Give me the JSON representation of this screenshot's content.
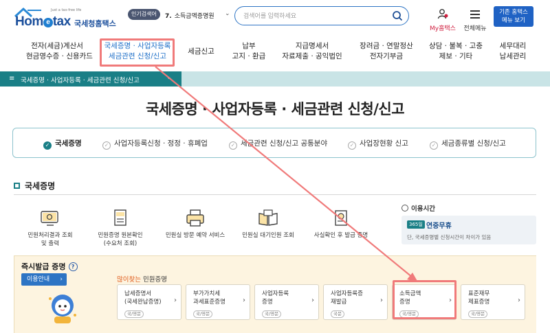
{
  "header": {
    "logo_tag": "Just a tax-free life",
    "logo_brand_pre": "Hom",
    "logo_brand_e": "e",
    "logo_brand_post": "tax",
    "logo_korean": "국세청홈택스",
    "popular_badge": "인기검색어",
    "popular_rank": "7.",
    "popular_keyword": "소득금액증명원",
    "search_placeholder": "검색어를 입력하세요",
    "my_hometax": "My홈택스",
    "all_menu": "전체메뉴",
    "legacy_line1": "기존 홈택스",
    "legacy_line2": "메뉴 보기"
  },
  "gnb": {
    "items": [
      {
        "line1": "전자(세금)계산서",
        "line2": "현금영수증 · 신용카드"
      },
      {
        "line1": "국세증명 · 사업자등록",
        "line2": "세금관련 신청/신고"
      },
      {
        "line1": "세금신고",
        "line2": ""
      },
      {
        "line1": "납부",
        "line2": "고지 · 환급"
      },
      {
        "line1": "지급명세서",
        "line2": "자료제출 · 공익법인"
      },
      {
        "line1": "장려금 · 연말정산",
        "line2": "전자기부금"
      },
      {
        "line1": "상담 · 불복 · 고충",
        "line2": "제보 · 기타"
      },
      {
        "line1": "세무대리",
        "line2": "납세관리"
      }
    ]
  },
  "breadcrumb": "국세증명 · 사업자등록 · 세금관련 신청/신고",
  "page_title": "국세증명 · 사업자등록 · 세금관련 신청/신고",
  "tabs": [
    "국세증명",
    "사업자등록신청 · 정정 · 휴폐업",
    "세금관련 신청/신고 공통분야",
    "사업장현황 신고",
    "세금종류별 신청/신고"
  ],
  "section_title": "국세증명",
  "services": [
    {
      "line1": "민원처리결과 조회",
      "line2": "및 출력"
    },
    {
      "line1": "민원증명 원본확인",
      "line2": "(수요처 조회)"
    },
    {
      "line1": "민원실 방문 예약 서비스",
      "line2": ""
    },
    {
      "line1": "민원실 대기인원 조회",
      "line2": ""
    },
    {
      "line1": "사실확인 후 발급 증명",
      "line2": ""
    }
  ],
  "use_time": {
    "heading": "이용시간",
    "badge": "365일",
    "value": "연중무휴",
    "note": "단, 국세증명별 신청시간이 차이가 있음"
  },
  "instant": {
    "title": "즉시발급 증명",
    "guide_button": "이용안내",
    "popular_a": "많이찾는",
    "popular_b": " 민원증명",
    "cards": [
      {
        "line1": "납세증명서",
        "line2": "(국세완납증명)",
        "tag": "국/영문"
      },
      {
        "line1": "부가가치세",
        "line2": "과세표준증명",
        "tag": "국/영문"
      },
      {
        "line1": "사업자등록",
        "line2": "증명",
        "tag": "국/영문"
      },
      {
        "line1": "사업자등록증",
        "line2": "재발급",
        "tag": "국문"
      },
      {
        "line1": "소득금액",
        "line2": "증명",
        "tag": "국/영문"
      },
      {
        "line1": "표준재무",
        "line2": "제표증명",
        "tag": "국/영문"
      }
    ]
  },
  "colors": {
    "brand_blue": "#1b4f9c",
    "teal": "#1a7f86",
    "highlight": "#f07a7a",
    "popular_orange": "#e05a1a"
  }
}
